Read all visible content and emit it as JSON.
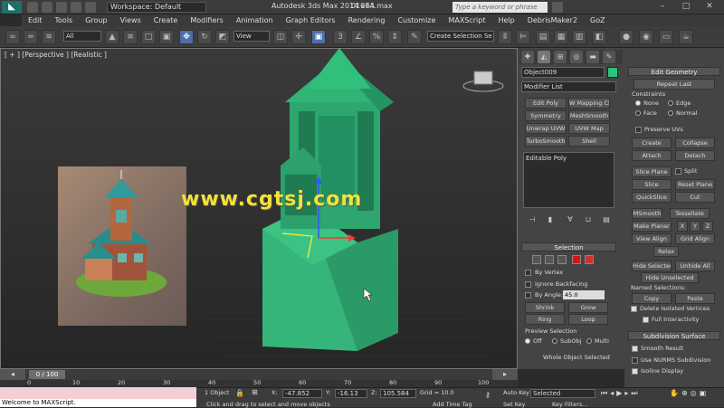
{
  "titlebar": {
    "workspace": "Workspace: Default",
    "app_title": "Autodesk 3ds Max  2014 x64",
    "file": "0107A.max",
    "search_placeholder": "Type a keyword or phrase"
  },
  "menu": [
    "Edit",
    "Tools",
    "Group",
    "Views",
    "Create",
    "Modifiers",
    "Animation",
    "Graph Editors",
    "Rendering",
    "Customize",
    "MAXScript",
    "Help",
    "DebrisMaker2",
    "GoZ"
  ],
  "toolbar": {
    "selection_filter": "All",
    "ref_coord": "View",
    "selection_set": "Create Selection Se"
  },
  "viewport": {
    "label": "[ + ] [Perspective ] [Realistic ]",
    "watermark": "www.cgtsj.com"
  },
  "command_panel": {
    "object_name": "Object009",
    "object_color": "#2ec27e",
    "modifier_list": "Modifier List",
    "modifier_buttons": [
      "Edit Poly",
      "W Mapping Cle",
      "Symmetry",
      "MeshSmooth",
      "Unwrap UVW",
      "UVW Map",
      "TurboSmooth",
      "Shell"
    ],
    "stack_item": "Editable Poly",
    "selection_header": "Selection",
    "by_vertex": "By Vertex",
    "ignore_backfacing": "Ignore Backfacing",
    "by_angle": "By Angle:",
    "angle_value": "45.0",
    "shrink": "Shrink",
    "grow": "Grow",
    "ring": "Ring",
    "loop": "Loop",
    "preview_selection": "Preview Selection",
    "off": "Off",
    "subobj": "SubObj",
    "multi": "Multi",
    "whole_object": "Whole Object Selected"
  },
  "edit_geometry": {
    "header": "Edit Geometry",
    "repeat_last": "Repeat Last",
    "constraints": "Constraints",
    "none": "None",
    "edge": "Edge",
    "face": "Face",
    "normal": "Normal",
    "preserve_uvs": "Preserve UVs",
    "create": "Create",
    "collapse": "Collapse",
    "attach": "Attach",
    "detach": "Detach",
    "slice_plane": "Slice Plane",
    "split": "Split",
    "slice": "Slice",
    "reset_plane": "Reset Plane",
    "quickslice": "QuickSlice",
    "cut": "Cut",
    "msmooth": "MSmooth",
    "tessellate": "Tessellate",
    "make_planar": "Make Planar",
    "x": "X",
    "y": "Y",
    "z": "Z",
    "view_align": "View Align",
    "grid_align": "Grid Align",
    "relax": "Relax",
    "hide_selected": "Hide Selected",
    "unhide_all": "Unhide All",
    "hide_unselected": "Hide Unselected",
    "named_selections": "Named Selections:",
    "copy": "Copy",
    "paste": "Paste",
    "delete_isolated": "Delete Isolated Vertices",
    "full_interactivity": "Full Interactivity",
    "subdivision_header": "Subdivision Surface",
    "smooth_result": "Smooth Result",
    "use_nurms": "Use NURMS Subdivision",
    "isoline": "Isoline Display"
  },
  "timeline": {
    "frame": "0 / 100",
    "ticks": [
      "0",
      "10",
      "20",
      "30",
      "40",
      "50",
      "60",
      "70",
      "80",
      "90",
      "100"
    ]
  },
  "status": {
    "maxscript": "Welcome to MAXScript.",
    "objects": "1 Object",
    "x_label": "X:",
    "x": "-47.852",
    "y_label": "Y:",
    "y": "-16.13",
    "z_label": "Z:",
    "z": "105.584",
    "grid": "Grid = 10.0",
    "prompt": "Click and drag to select and move objects",
    "add_time_tag": "Add Time Tag",
    "auto_key": "Auto Key",
    "selected": "Selected",
    "set_key": "Set Key",
    "key_filters": "Key Filters..."
  }
}
